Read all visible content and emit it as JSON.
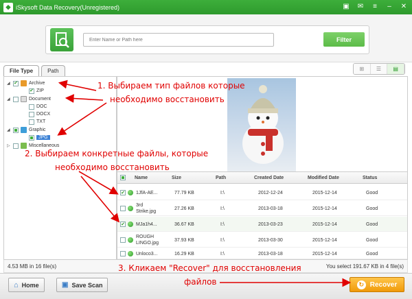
{
  "window": {
    "title": "iSkysoft Data Recovery(Unregistered)"
  },
  "search": {
    "placeholder": "Enter Name or Path here",
    "filter_label": "Filter"
  },
  "tabs": [
    {
      "label": "File Type"
    },
    {
      "label": "Path"
    }
  ],
  "tree": {
    "archive": "Archive",
    "zip": "ZIP",
    "document": "Document",
    "doc": "DOC",
    "docx": "DOCX",
    "txt": "TXT",
    "graphic": "Graphic",
    "jpg": "JPG",
    "misc": "Miscellaneous"
  },
  "table": {
    "headers": {
      "name": "Name",
      "size": "Size",
      "path": "Path",
      "created": "Created Date",
      "modified": "Modified Date",
      "status": "Status"
    },
    "rows": [
      {
        "name": "1JfA-AE...",
        "size": "77.79 KB",
        "path": "I:\\",
        "created": "2012-12-24",
        "modified": "2015-12-14",
        "status": "Good",
        "checked": true
      },
      {
        "name": "3rd Strike.jpg",
        "size": "27.26 KB",
        "path": "I:\\",
        "created": "2013-03-18",
        "modified": "2015-12-14",
        "status": "Good",
        "checked": false
      },
      {
        "name": "MJa1h4...",
        "size": "36.67 KB",
        "path": "I:\\",
        "created": "2013-03-23",
        "modified": "2015-12-14",
        "status": "Good",
        "checked": true
      },
      {
        "name": "ROUGH LINGO.jpg",
        "size": "37.93 KB",
        "path": "I:\\",
        "created": "2013-03-30",
        "modified": "2015-12-14",
        "status": "Good",
        "checked": false
      },
      {
        "name": "Unloco3...",
        "size": "16.29 KB",
        "path": "I:\\",
        "created": "2013-03-18",
        "modified": "2015-12-14",
        "status": "Good",
        "checked": false
      }
    ]
  },
  "status": {
    "left": "4.53 MB in 16 file(s)",
    "right": "You select 191.67 KB in 4 file(s)"
  },
  "buttons": {
    "home": "Home",
    "save_scan": "Save Scan",
    "recover": "Recover"
  },
  "annotations": {
    "a1_line1": "1. Выбираем тип файлов которые",
    "a1_line2": "необходимо восстановить",
    "a2_line1": "2. Выбираем конкретные файлы, которые",
    "a2_line2": "необходимо восстановить",
    "a3_line1": "3. Кликаем \"Recover\" для восстановления",
    "a3_line2": "файлов"
  },
  "colors": {
    "brand_green": "#2e9a2d",
    "recover_orange": "#f09a0a",
    "annotation_red": "#e00000"
  }
}
